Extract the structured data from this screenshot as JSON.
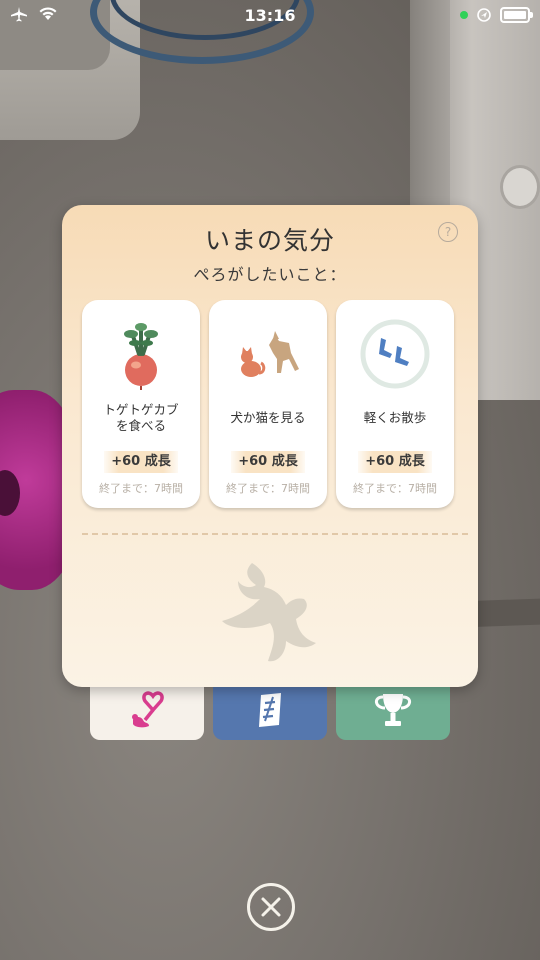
{
  "status_bar": {
    "time": "13:16",
    "icons": [
      "airplane-icon",
      "wifi-icon",
      "location-icon",
      "battery-icon"
    ]
  },
  "modal": {
    "title": "いまの気分",
    "help_label": "?",
    "subtitle": "ぺろがしたいこと：",
    "options": [
      {
        "label": "トゲトゲカブ\nを食べる",
        "reward": "+60 成長",
        "time_left": "終了まで：7時間",
        "icon": "turnip-icon"
      },
      {
        "label": "犬か猫を見る",
        "reward": "+60 成長",
        "time_left": "終了まで：7時間",
        "icon": "dog-cat-icon"
      },
      {
        "label": "軽くお散歩",
        "reward": "+60 成長",
        "time_left": "終了まで：7時間",
        "icon": "footprints-icon"
      }
    ],
    "pet_silhouette_icon": "pet-silhouette-icon"
  },
  "tabs": [
    {
      "icon": "pet-heart-icon",
      "color": "#f6f1ea"
    },
    {
      "icon": "quest-scroll-icon",
      "color": "#5577ae"
    },
    {
      "icon": "trophy-icon",
      "color": "#6fae92"
    }
  ],
  "close_icon": "close-icon",
  "colors": {
    "card_top": "#f7dbb6",
    "card_bottom": "#fbf3e5",
    "accent_pink": "#d93d8f",
    "scroll_blue": "#5577ae",
    "trophy_green": "#6fae92"
  }
}
